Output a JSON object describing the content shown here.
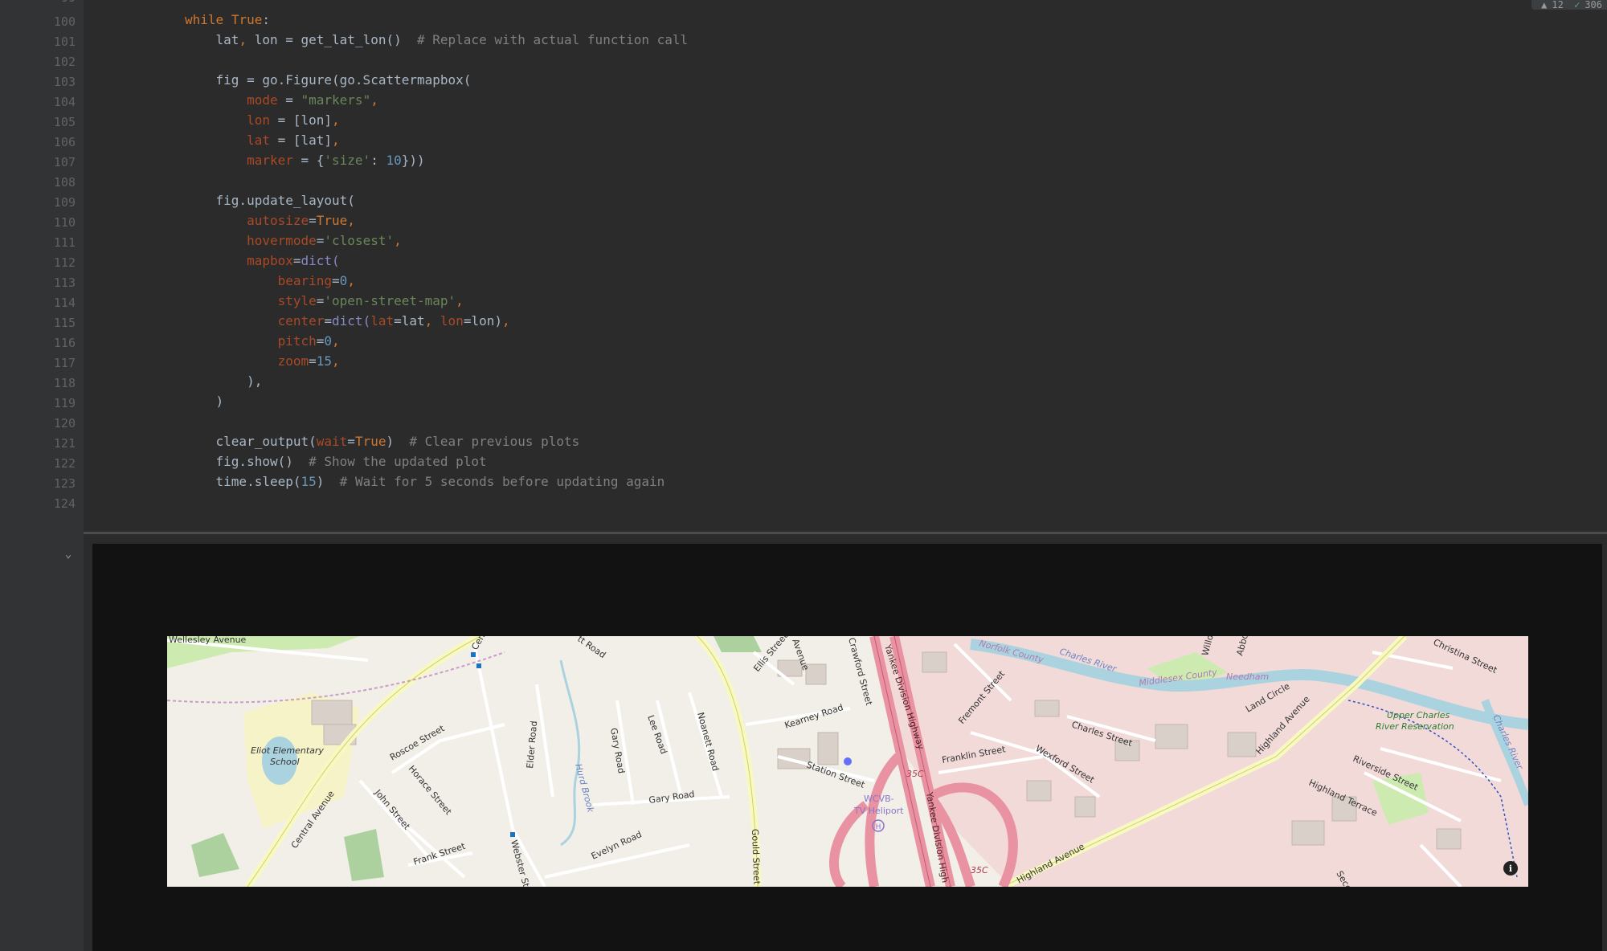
{
  "status": {
    "warnings": "12",
    "checks": "306"
  },
  "editor": {
    "first_line_partial": "99",
    "lines": [
      {
        "n": "100"
      },
      {
        "n": "101"
      },
      {
        "n": "102"
      },
      {
        "n": "103"
      },
      {
        "n": "104"
      },
      {
        "n": "105"
      },
      {
        "n": "106"
      },
      {
        "n": "107"
      },
      {
        "n": "108"
      },
      {
        "n": "109"
      },
      {
        "n": "110"
      },
      {
        "n": "111"
      },
      {
        "n": "112"
      },
      {
        "n": "113"
      },
      {
        "n": "114"
      },
      {
        "n": "115"
      },
      {
        "n": "116"
      },
      {
        "n": "117"
      },
      {
        "n": "118"
      },
      {
        "n": "119"
      },
      {
        "n": "120"
      },
      {
        "n": "121"
      },
      {
        "n": "122"
      },
      {
        "n": "123"
      },
      {
        "n": "124"
      }
    ]
  },
  "code": {
    "l100": {
      "kw": "while",
      "t": "True",
      ":": ":"
    },
    "l101": {
      "a": "lat",
      "b": "lon",
      "c": " = get_lat_lon()  ",
      "cmt": "# Replace with actual function call"
    },
    "l103": "fig = go.Figure(go.Scattermapbox(",
    "l104": {
      "p": "mode",
      "s": "\"markers\""
    },
    "l105": {
      "p": "lon",
      "v": "[lon]"
    },
    "l106": {
      "p": "lat",
      "v": "[lat]"
    },
    "l107": {
      "p": "marker",
      "k": "'size'",
      "n": "10",
      "end": "}))"
    },
    "l109": "fig.update_layout(",
    "l110": {
      "p": "autosize",
      "v": "True"
    },
    "l111": {
      "p": "hovermode",
      "s": "'closest'"
    },
    "l112": {
      "p": "mapbox",
      "v": "dict("
    },
    "l113": {
      "p": "bearing",
      "n": "0"
    },
    "l114": {
      "p": "style",
      "s": "'open-street-map'"
    },
    "l115": {
      "p": "center",
      "f": "dict(",
      "p1": "lat",
      "v1": "lat",
      "p2": "lon",
      "v2": "lon)"
    },
    "l116": {
      "p": "pitch",
      "n": "0"
    },
    "l117": {
      "p": "zoom",
      "n": "15"
    },
    "l118": "),",
    "l119": ")",
    "l121": {
      "f": "clear_output(",
      "p": "wait",
      "v": "True",
      "c": ")  ",
      "cmt": "# Clear previous plots"
    },
    "l122": {
      "f": "fig.show()  ",
      "cmt": "# Show the updated plot"
    },
    "l123": {
      "f": "time.sleep(",
      "n": "15",
      "c": ")  ",
      "cmt": "# Wait for 5 seconds before updating again"
    }
  },
  "map": {
    "labels": {
      "wellesley_ave": "Wellesley Avenue",
      "eliot_school": "Eliot Elementary",
      "eliot_school2": "School",
      "central_ave": "Central Avenue",
      "roscoe": "Roscoe Street",
      "horace": "Horace Street",
      "john": "John Street",
      "frank": "Frank Street",
      "webster": "Webster Street",
      "elder": "Elder Road",
      "gary_rd": "Gary Road",
      "gary_rd2": "Gary Road",
      "lee": "Lee Road",
      "noanett": "Noanett Road",
      "hurd_brook": "Hurd Brook",
      "evelyn": "Evelyn Road",
      "gould": "Gould Street",
      "ellis": "Ellis Street",
      "avenue": "Avenue",
      "crawford": "Crawford Street",
      "kearney": "Kearney Road",
      "station": "Station Street",
      "wcvb": "WCVB-",
      "wcvb2": "TV Heliport",
      "yankee": "Yankee Division Highway",
      "yankee2": "Yankee Division High",
      "r35c": "35C",
      "r35c2": "35C",
      "norfolk": "Norfolk County",
      "charles_river": "Charles River",
      "middlesex": "Middlesex County",
      "needham": "Needham",
      "fremont": "Fremont Street",
      "franklin": "Franklin Street",
      "charles_st": "Charles Street",
      "wexford": "Wexford Street",
      "highland_ave": "Highland Avenue",
      "highland_ave2": "Highland Avenue",
      "land_circle": "Land Circle",
      "christina": "Christina Street",
      "upper_charles": "Upper Charles",
      "river_res": "River Reservation",
      "riverside": "Riverside Street",
      "highland_terr": "Highland Terrace",
      "charles_river2": "Charles River",
      "willow": "Willow",
      "abbott": "Abbott",
      "road_frag": "tt Road",
      "cen": "Cen",
      "seco": "Seco"
    },
    "info_icon": "i"
  },
  "colors": {
    "map_bg": "#f2efe9",
    "highway": "#e892a2",
    "primary": "#fcd6a4",
    "secondary": "#f7fabf",
    "water": "#aad3df",
    "park": "#cdebb0",
    "residential": "#e0dfdf",
    "commercial": "#f2dad9",
    "marker": "#636efa"
  }
}
